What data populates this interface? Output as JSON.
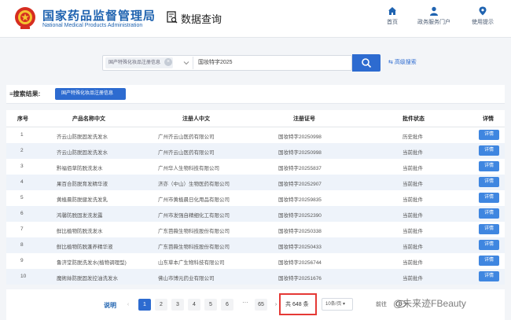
{
  "header": {
    "brand_cn": "国家药品监督管理局",
    "brand_en": "National Medical Products Administration",
    "page_title": "数据查询",
    "nav": [
      {
        "label": "首页",
        "icon": "home-icon"
      },
      {
        "label": "政务服务门户",
        "icon": "user-icon"
      },
      {
        "label": "使用提示",
        "icon": "location-pin-icon"
      }
    ]
  },
  "search": {
    "category_chip": "国产特殊化妆品注册信息",
    "query": "国妆特字2025",
    "advanced_label": "高级搜索"
  },
  "results": {
    "label": "搜索结果:",
    "tag": "国产特殊化妆品注册信息"
  },
  "table": {
    "columns": [
      "序号",
      "产品名称中文",
      "注册人中文",
      "注册证号",
      "批件状态",
      "详情"
    ],
    "detail_label": "详情",
    "rows": [
      {
        "no": "1",
        "product": "齐云山防脱固发洗发水",
        "registrant": "广州齐云山医药有限公司",
        "cert": "国妆特字20250998",
        "status": "历史批件"
      },
      {
        "no": "2",
        "product": "齐云山防脱固发洗发水",
        "registrant": "广州齐云山医药有限公司",
        "cert": "国妆特字20250998",
        "status": "当前批件"
      },
      {
        "no": "3",
        "product": "黔福佰草防脱洗发水",
        "registrant": "广州华人生物科技有限公司",
        "cert": "国妆特字20255837",
        "status": "当前批件"
      },
      {
        "no": "4",
        "product": "果百合防脱育发精华液",
        "registrant": "济亦（中山）生物医药有限公司",
        "cert": "国妆特字20252907",
        "status": "当前批件"
      },
      {
        "no": "5",
        "product": "黄植晨防脱健发洗发乳",
        "registrant": "广州市黄植晨日化用品有限公司",
        "cert": "国妆特字20259835",
        "status": "当前批件"
      },
      {
        "no": "6",
        "product": "鸿馨防脱固发洗发露",
        "registrant": "广州市发强自精细化工有限公司",
        "cert": "国妆特字20252390",
        "status": "当前批件"
      },
      {
        "no": "7",
        "product": "鲜比植物防脱洗发水",
        "registrant": "广东芭薇生物科技股份有限公司",
        "cert": "国妆特字20250338",
        "status": "当前批件"
      },
      {
        "no": "8",
        "product": "鲜比植物防脱蓬养精华液",
        "registrant": "广东芭薇生物科技股份有限公司",
        "cert": "国妆特字20250433",
        "status": "当前批件"
      },
      {
        "no": "9",
        "product": "鲁济堂防脱洗发水(植物调理型)",
        "registrant": "山东草本广生物科技有限公司",
        "cert": "国妆特字20256744",
        "status": "当前批件"
      },
      {
        "no": "10",
        "product": "魔術絲防脱固发控油洗发水",
        "registrant": "佛山市博元药业有限公司",
        "cert": "国妆特字20251676",
        "status": "当前批件"
      }
    ]
  },
  "pagination": {
    "explain": "说明",
    "pages": [
      "1",
      "2",
      "3",
      "4",
      "5",
      "6"
    ],
    "ellipsis": "···",
    "last_page": "65",
    "total": "共 648 条",
    "page_size": "10条/页",
    "goto": "前往"
  },
  "watermark": "@未来迹FBeauty",
  "colors": {
    "brand": "#1f63b0",
    "accent": "#2d6bd0",
    "highlight": "#e53935"
  }
}
